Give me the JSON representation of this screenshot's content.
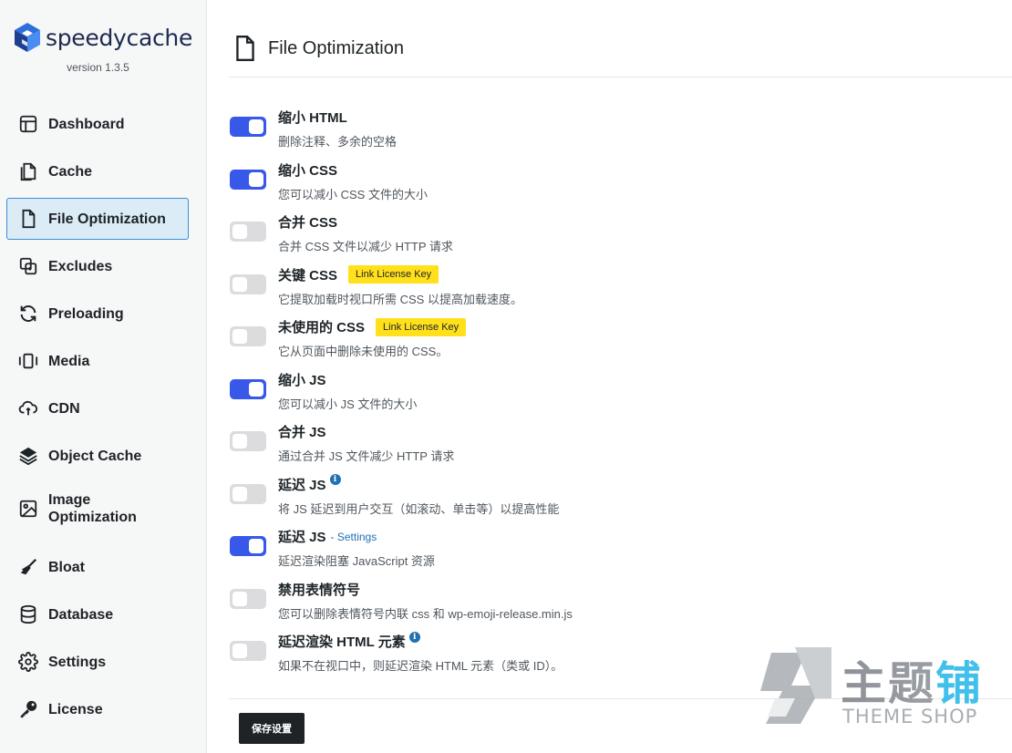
{
  "brand": {
    "name": "speedycache",
    "version": "version 1.3.5"
  },
  "nav": [
    {
      "key": "dashboard",
      "label": "Dashboard",
      "icon": "dashboard-icon"
    },
    {
      "key": "cache",
      "label": "Cache",
      "icon": "files-icon"
    },
    {
      "key": "file-optimization",
      "label": "File Optimization",
      "icon": "file-icon",
      "active": true
    },
    {
      "key": "excludes",
      "label": "Excludes",
      "icon": "excludes-icon"
    },
    {
      "key": "preloading",
      "label": "Preloading",
      "icon": "refresh-icon"
    },
    {
      "key": "media",
      "label": "Media",
      "icon": "carousel-icon"
    },
    {
      "key": "cdn",
      "label": "CDN",
      "icon": "cloud-sync-icon"
    },
    {
      "key": "object-cache",
      "label": "Object Cache",
      "icon": "layers-icon"
    },
    {
      "key": "image-optimization",
      "label": "Image Optimization",
      "icon": "image-icon"
    },
    {
      "key": "bloat",
      "label": "Bloat",
      "icon": "broom-icon"
    },
    {
      "key": "database",
      "label": "Database",
      "icon": "database-icon"
    },
    {
      "key": "settings",
      "label": "Settings",
      "icon": "gear-icon"
    },
    {
      "key": "license",
      "label": "License",
      "icon": "key-icon"
    }
  ],
  "header": {
    "title": "File Optimization",
    "icon": "file-icon"
  },
  "options": [
    {
      "title": "缩小 HTML",
      "desc": "删除注释、多余的空格",
      "enabled": true
    },
    {
      "title": "缩小 CSS",
      "desc": "您可以减小 CSS 文件的大小",
      "enabled": true
    },
    {
      "title": "合并 CSS",
      "desc": "合并 CSS 文件以减少 HTTP 请求",
      "enabled": false
    },
    {
      "title": "关键 CSS",
      "desc": "它提取加载时视口所需 CSS 以提高加载速度。",
      "enabled": false,
      "badge": "Link License Key"
    },
    {
      "title": "未使用的 CSS",
      "desc": "它从页面中删除未使用的 CSS。",
      "enabled": false,
      "badge": "Link License Key"
    },
    {
      "title": "缩小 JS",
      "desc": "您可以减小 JS 文件的大小",
      "enabled": true
    },
    {
      "title": "合并 JS",
      "desc": "通过合并 JS 文件减少 HTTP 请求",
      "enabled": false
    },
    {
      "title": "延迟 JS",
      "desc": "将 JS 延迟到用户交互（如滚动、单击等）以提高性能",
      "enabled": false,
      "info": true
    },
    {
      "title": "延迟 JS",
      "desc": "延迟渲染阻塞 JavaScript 资源",
      "enabled": true,
      "link": "- Settings"
    },
    {
      "title": "禁用表情符号",
      "desc": "您可以删除表情符号内联 css 和 wp-emoji-release.min.js",
      "enabled": false
    },
    {
      "title": "延迟渲染 HTML 元素",
      "desc": "如果不在视口中，则延迟渲染 HTML 元素（类或 ID）。",
      "enabled": false,
      "info": true
    }
  ],
  "save_button": "保存设置",
  "watermark": {
    "cn": "主题铺",
    "en": "THEME SHOP"
  },
  "colors": {
    "accent": "#3858e9",
    "active_nav_bg": "#dcecf7",
    "active_nav_border": "#3b8ed6",
    "badge": "#ffe01b"
  }
}
